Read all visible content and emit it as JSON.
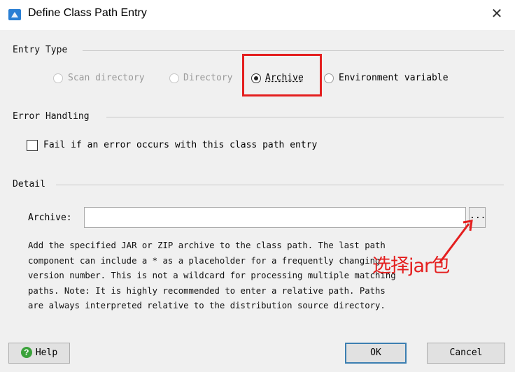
{
  "window": {
    "title": "Define Class Path Entry",
    "close_glyph": "✕"
  },
  "entry_type": {
    "label": "Entry Type",
    "options": [
      {
        "label": "Scan directory",
        "state": "disabled"
      },
      {
        "label": "Directory",
        "state": "disabled"
      },
      {
        "label": "Archive",
        "state": "checked"
      },
      {
        "label": "Environment variable",
        "state": "unchecked"
      }
    ]
  },
  "error_handling": {
    "label": "Error Handling",
    "checkbox_label": "Fail if an error occurs with this class path entry",
    "checked": false
  },
  "detail": {
    "label": "Detail",
    "archive_label": "Archive:",
    "archive_value": "",
    "browse_label": "...",
    "description_lines": [
      "Add the specified JAR or ZIP archive to the class path. The last path",
      "component can include a * as a placeholder for a frequently changing",
      "version number. This is not a wildcard for processing multiple matching",
      "paths. Note: It is highly recommended to enter a relative path. Paths",
      "are always interpreted relative to the distribution source directory."
    ]
  },
  "annotation": {
    "text": "选择jar包",
    "color": "#e41f1f"
  },
  "buttons": {
    "help": "Help",
    "ok": "OK",
    "cancel": "Cancel"
  },
  "icons": {
    "app": "install4j-window-icon",
    "help": "help-question-icon"
  }
}
